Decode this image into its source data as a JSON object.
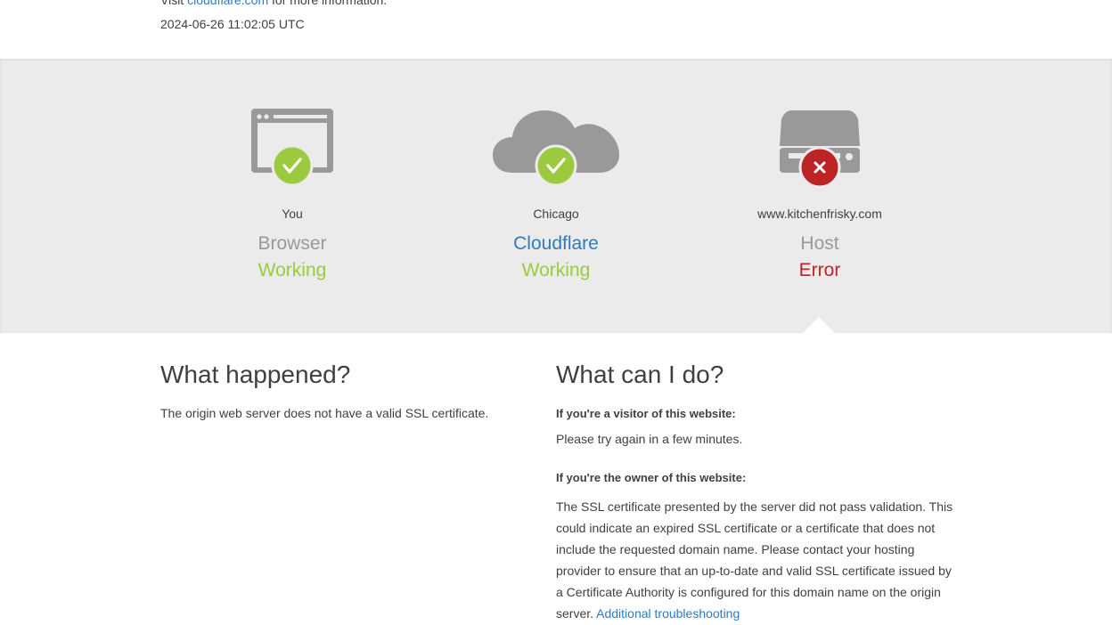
{
  "header": {
    "visit_prefix": "Visit",
    "visit_link": "cloudflare.com",
    "visit_suffix": "for more information.",
    "timestamp": "2024-06-26 11:02:05 UTC"
  },
  "status": [
    {
      "place": "You",
      "role": "Browser",
      "state": "Working",
      "icon": "browser-icon",
      "badge": "check-icon"
    },
    {
      "place": "Chicago",
      "role": "Cloudflare",
      "state": "Working",
      "icon": "cloud-icon",
      "badge": "check-icon"
    },
    {
      "place": "www.kitchenfrisky.com",
      "role": "Host",
      "state": "Error",
      "icon": "server-icon",
      "badge": "x-icon"
    }
  ],
  "colors": {
    "ok": "#9bca3e",
    "error": "#bd2426",
    "link": "#2f7bbf",
    "band": "#ebebeb"
  },
  "what_happened": {
    "title": "What happened?",
    "text": "The origin web server does not have a valid SSL certificate."
  },
  "what_can_i_do": {
    "title": "What can I do?",
    "visitor_heading": "If you're a visitor of this website:",
    "visitor_text": "Please try again in a few minutes.",
    "owner_heading": "If you're the owner of this website:",
    "owner_text": "The SSL certificate presented by the server did not pass validation. This could indicate an expired SSL certificate or a certificate that does not include the requested domain name. Please contact your hosting provider to ensure that an up-to-date and valid SSL certificate issued by a Certificate Authority is configured for this domain name on the origin server.",
    "owner_link": "Additional troubleshooting"
  }
}
